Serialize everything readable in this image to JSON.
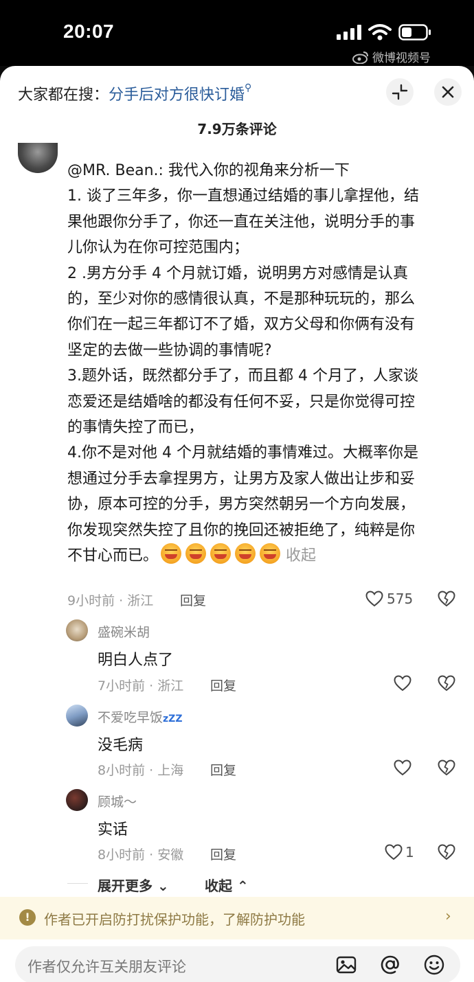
{
  "status_bar": {
    "time": "20:07"
  },
  "watermark": {
    "text": "微博视频号"
  },
  "header": {
    "hot_search_label": "大家都在搜：",
    "hot_search_query": "分手后对方很快订婚",
    "comment_count": "7.9万条评论"
  },
  "main_comment": {
    "lines": [
      "@MR. Bean.: 我代入你的视角来分析一下",
      "1. 谈了三年多，你一直想通过结婚的事儿拿捏他，结",
      "果他跟你分手了，你还一直在关注他，说明分手的事",
      "儿你认为在你可控范围内；",
      "2 .男方分手 4 个月就订婚，说明男方对感情是认真",
      "的，至少对你的感情很认真，不是那种玩玩的，那么",
      "你们在一起三年都订不了婚，双方父母和你俩有没有",
      "坚定的去做一些协调的事情呢?",
      "3.题外话，既然都分手了，而且都 4 个月了，人家谈",
      "恋爱还是结婚啥的都没有任何不妥，只是你觉得可控",
      "的事情失控了而已，",
      "4.你不是对他 4 个月就结婚的事情难过。大概率你是",
      "想通过分手去拿捏男方，让男方及家人做出让步和妥",
      "协，原本可控的分手，男方突然朝另一个方向发展，",
      "你发现突然失控了且你的挽回还被拒绝了，纯粹是你"
    ],
    "last_line": "不甘心而已。",
    "emoji_count": 5,
    "collapse_label": "收起",
    "meta": "9小时前 · 浙江",
    "reply_label": "回复",
    "likes": "575"
  },
  "replies": [
    {
      "name": "盛碗米胡",
      "text": "明白人点了",
      "meta": "7小时前 · 浙江",
      "reply_label": "回复",
      "likes": ""
    },
    {
      "name": "不爱吃早饭",
      "name_suffix": "zZZ",
      "text": "没毛病",
      "meta": "8小时前 · 上海",
      "reply_label": "回复",
      "likes": ""
    },
    {
      "name": "顾城～",
      "text": "实话",
      "meta": "8小时前 · 安徽",
      "reply_label": "回复",
      "likes": "1"
    }
  ],
  "expand": {
    "more_label": "展开更多",
    "collapse_label": "收起"
  },
  "protection_banner": {
    "text": "作者已开启防打扰保护功能，了解防护功能",
    "icon": "!"
  },
  "input_bar": {
    "placeholder": "作者仅允许互关朋友评论"
  },
  "icons": {
    "status": [
      "signal-icon",
      "wifi-icon",
      "battery-icon"
    ],
    "header": [
      "collapse-icon",
      "close-icon"
    ],
    "actions": [
      "heart-icon",
      "dislike-heart-icon"
    ],
    "input": [
      "image-icon",
      "at-icon",
      "emoji-icon"
    ]
  },
  "colors": {
    "link_blue": "#2a5c9a",
    "banner_bg": "#fdf8e6",
    "banner_text": "#8e7a45",
    "meta_gray": "#999999"
  }
}
